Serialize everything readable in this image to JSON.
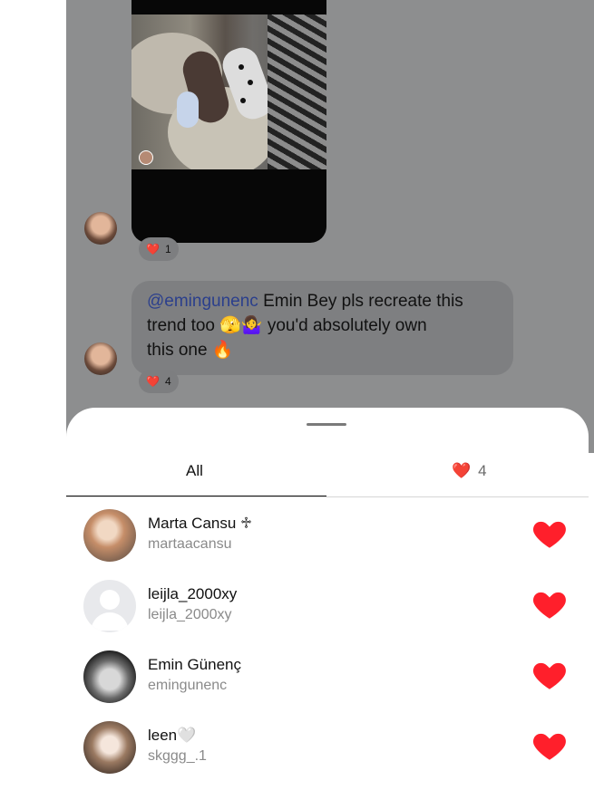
{
  "chat": {
    "post_reaction": {
      "emoji": "❤️",
      "count": "1"
    },
    "message": {
      "mention": "@emingunenc",
      "line1_rest": " Emin Bey pls recreate this",
      "line2": "trend too 🫣🤷‍♀️  you'd absolutely own",
      "line3": "this one 🔥",
      "reaction_emoji": "❤️",
      "reaction_count": "4"
    }
  },
  "sheet": {
    "tabs": [
      {
        "label": "All",
        "selected": true
      },
      {
        "label": "4",
        "emoji": "❤️"
      }
    ],
    "users": [
      {
        "name": "Marta Cansu ♱",
        "username": "martaacansu",
        "reaction": "❤️"
      },
      {
        "name": "leijla_2000xy",
        "username": "leijla_2000xy",
        "reaction": "❤️"
      },
      {
        "name": "Emin Günenç",
        "username": "emingunenc",
        "reaction": "❤️"
      },
      {
        "name": "leen🤍",
        "username": "skggg_.1",
        "reaction": "❤️"
      }
    ]
  },
  "colors": {
    "heart": "#ff1f2b",
    "overlay": "#8d8e8f"
  }
}
